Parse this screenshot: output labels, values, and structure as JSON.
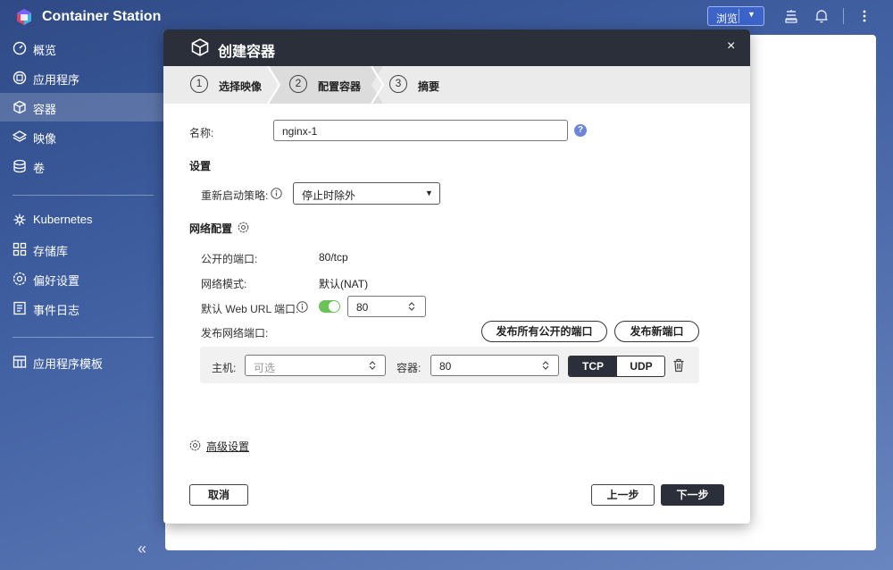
{
  "app": {
    "title": "Container Station"
  },
  "topbar": {
    "browse_label": "浏览"
  },
  "sidebar": {
    "items": [
      {
        "label": "概览",
        "icon": "gauge-icon"
      },
      {
        "label": "应用程序",
        "icon": "app-icon"
      },
      {
        "label": "容器",
        "icon": "cube-icon",
        "active": true
      },
      {
        "label": "映像",
        "icon": "layers-icon"
      },
      {
        "label": "卷",
        "icon": "database-icon"
      },
      {
        "label": "Kubernetes",
        "icon": "kubernetes-icon"
      },
      {
        "label": "存储库",
        "icon": "grid-icon"
      },
      {
        "label": "偏好设置",
        "icon": "gear-icon"
      },
      {
        "label": "事件日志",
        "icon": "log-icon"
      },
      {
        "label": "应用程序模板",
        "icon": "template-icon"
      }
    ],
    "collapse_glyph": "«"
  },
  "dialog": {
    "title": "创建容器",
    "close_glyph": "×",
    "steps": [
      {
        "num": "1",
        "label": "选择映像"
      },
      {
        "num": "2",
        "label": "配置容器"
      },
      {
        "num": "3",
        "label": "摘要"
      }
    ],
    "name_label": "名称:",
    "name_value": "nginx-1",
    "help_glyph": "?",
    "settings_heading": "设置",
    "restart_label": "重新启动策略:",
    "restart_value": "停止时除外",
    "network_heading": "网络配置",
    "exposed_ports_label": "公开的端口:",
    "exposed_ports_value": "80/tcp",
    "network_mode_label": "网络模式:",
    "network_mode_value": "默认(NAT)",
    "web_url_label": "默认 Web URL 端口:",
    "web_url_enabled": true,
    "web_url_port": "80",
    "publish_label": "发布网络端口:",
    "publish_all_label": "发布所有公开的端口",
    "publish_new_label": "发布新端口",
    "host_label": "主机:",
    "host_placeholder": "可选",
    "container_label": "容器:",
    "container_port": "80",
    "protocol_tcp": "TCP",
    "protocol_udp": "UDP",
    "protocol_selected": "TCP",
    "advanced_label": "高级设置",
    "cancel_label": "取消",
    "prev_label": "上一步",
    "next_label": "下一步"
  },
  "colors": {
    "accent_dark": "#2b2f3a",
    "toggle_on": "#6ac259",
    "help_blue": "#6b86d8"
  }
}
